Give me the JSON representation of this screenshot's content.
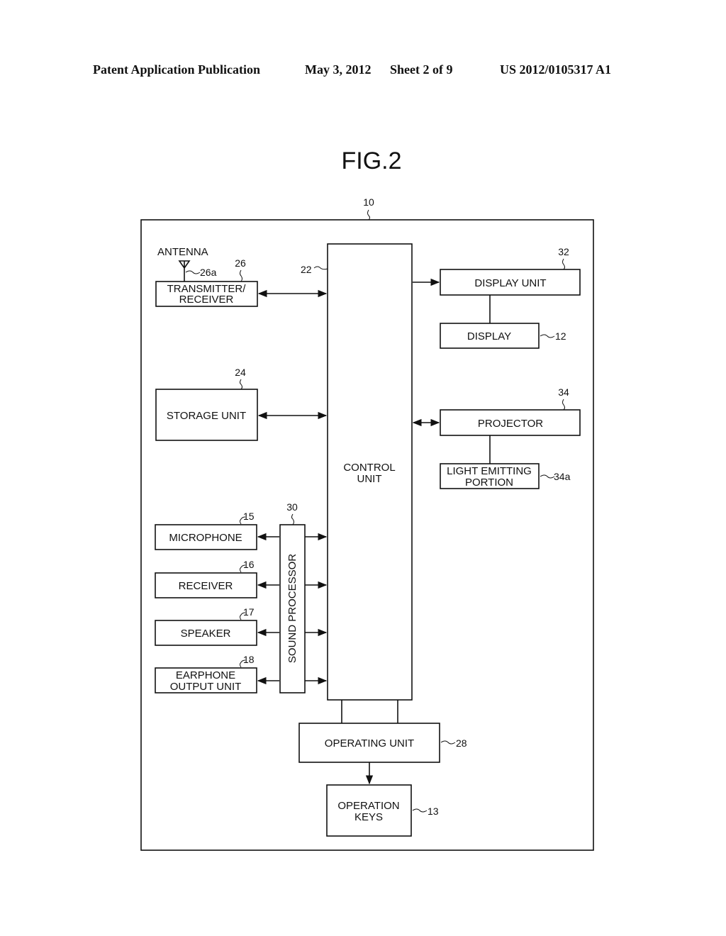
{
  "header": {
    "publication": "Patent Application Publication",
    "date": "May 3, 2012",
    "sheet": "Sheet 2 of 9",
    "number": "US 2012/0105317 A1"
  },
  "figure": {
    "title": "FIG.2",
    "device_ref": "10"
  },
  "blocks": {
    "antenna": {
      "label": "ANTENNA",
      "ref": "26a"
    },
    "transmitter_receiver": {
      "line1": "TRANSMITTER/",
      "line2": "RECEIVER",
      "ref": "26"
    },
    "control_unit": {
      "line1": "CONTROL",
      "line2": "UNIT",
      "ref": "22"
    },
    "display_unit": {
      "label": "DISPLAY UNIT",
      "ref": "32"
    },
    "display": {
      "label": "DISPLAY",
      "ref": "12"
    },
    "storage_unit": {
      "label": "STORAGE UNIT",
      "ref": "24"
    },
    "projector": {
      "label": "PROJECTOR",
      "ref": "34"
    },
    "light_emitting_portion": {
      "line1": "LIGHT EMITTING",
      "line2": "PORTION",
      "ref": "34a"
    },
    "sound_processor": {
      "label": "SOUND PROCESSOR",
      "ref": "30"
    },
    "microphone": {
      "label": "MICROPHONE",
      "ref": "15"
    },
    "receiver": {
      "label": "RECEIVER",
      "ref": "16"
    },
    "speaker": {
      "label": "SPEAKER",
      "ref": "17"
    },
    "earphone_output_unit": {
      "line1": "EARPHONE",
      "line2": "OUTPUT UNIT",
      "ref": "18"
    },
    "operating_unit": {
      "label": "OPERATING UNIT",
      "ref": "28"
    },
    "operation_keys": {
      "line1": "OPERATION",
      "line2": "KEYS",
      "ref": "13"
    }
  }
}
